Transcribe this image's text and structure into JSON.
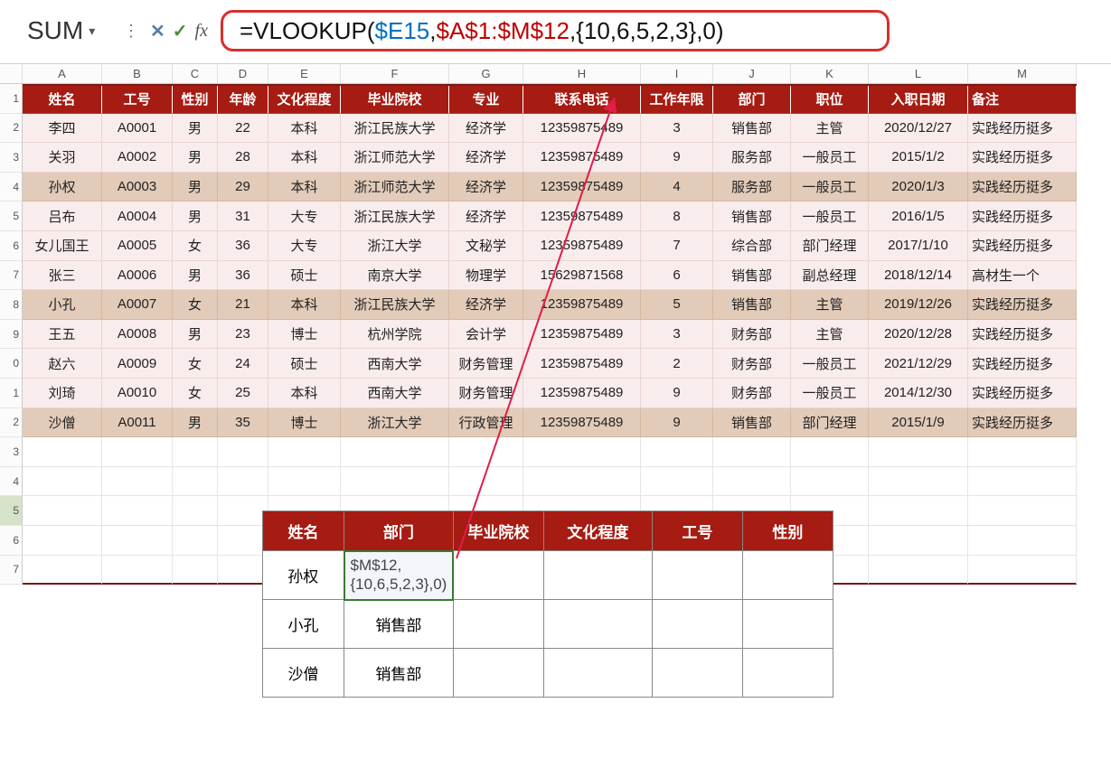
{
  "name_box": {
    "value": "SUM"
  },
  "formula": {
    "prefix": "=VLOOKUP(",
    "arg1": "$E15",
    "sep1": ",",
    "arg2": "$A$1:$M$12",
    "rest": ",{10,6,5,2,3},0)"
  },
  "col_labels": [
    "A",
    "B",
    "C",
    "D",
    "E",
    "F",
    "G",
    "H",
    "I",
    "J",
    "K",
    "L",
    "M"
  ],
  "row_labels": [
    "1",
    "2",
    "3",
    "4",
    "5",
    "6",
    "7",
    "8",
    "9",
    "0",
    "1",
    "2",
    "3",
    "4",
    "5",
    "6",
    "7"
  ],
  "selected_row_index": 14,
  "headers": {
    "name": "姓名",
    "id": "工号",
    "sex": "性别",
    "age": "年龄",
    "edu": "文化程度",
    "school": "毕业院校",
    "major": "专业",
    "phone": "联系电话",
    "years": "工作年限",
    "dept": "部门",
    "title": "职位",
    "hire": "入职日期",
    "note": "备注"
  },
  "rows": [
    {
      "name": "李四",
      "id": "A0001",
      "sex": "男",
      "age": "22",
      "edu": "本科",
      "school": "浙江民族大学",
      "major": "经济学",
      "phone": "12359875489",
      "years": "3",
      "dept": "销售部",
      "title": "主管",
      "hire": "2020/12/27",
      "note": "实践经历挺多",
      "shade": "light"
    },
    {
      "name": "关羽",
      "id": "A0002",
      "sex": "男",
      "age": "28",
      "edu": "本科",
      "school": "浙江师范大学",
      "major": "经济学",
      "phone": "12359875489",
      "years": "9",
      "dept": "服务部",
      "title": "一般员工",
      "hire": "2015/1/2",
      "note": "实践经历挺多",
      "shade": "light"
    },
    {
      "name": "孙权",
      "id": "A0003",
      "sex": "男",
      "age": "29",
      "edu": "本科",
      "school": "浙江师范大学",
      "major": "经济学",
      "phone": "12359875489",
      "years": "4",
      "dept": "服务部",
      "title": "一般员工",
      "hire": "2020/1/3",
      "note": "实践经历挺多",
      "shade": "dark"
    },
    {
      "name": "吕布",
      "id": "A0004",
      "sex": "男",
      "age": "31",
      "edu": "大专",
      "school": "浙江民族大学",
      "major": "经济学",
      "phone": "12359875489",
      "years": "8",
      "dept": "销售部",
      "title": "一般员工",
      "hire": "2016/1/5",
      "note": "实践经历挺多",
      "shade": "light"
    },
    {
      "name": "女儿国王",
      "id": "A0005",
      "sex": "女",
      "age": "36",
      "edu": "大专",
      "school": "浙江大学",
      "major": "文秘学",
      "phone": "12359875489",
      "years": "7",
      "dept": "综合部",
      "title": "部门经理",
      "hire": "2017/1/10",
      "note": "实践经历挺多",
      "shade": "light"
    },
    {
      "name": "张三",
      "id": "A0006",
      "sex": "男",
      "age": "36",
      "edu": "硕士",
      "school": "南京大学",
      "major": "物理学",
      "phone": "15629871568",
      "years": "6",
      "dept": "销售部",
      "title": "副总经理",
      "hire": "2018/12/14",
      "note": "高材生一个",
      "shade": "light"
    },
    {
      "name": "小孔",
      "id": "A0007",
      "sex": "女",
      "age": "21",
      "edu": "本科",
      "school": "浙江民族大学",
      "major": "经济学",
      "phone": "12359875489",
      "years": "5",
      "dept": "销售部",
      "title": "主管",
      "hire": "2019/12/26",
      "note": "实践经历挺多",
      "shade": "dark"
    },
    {
      "name": "王五",
      "id": "A0008",
      "sex": "男",
      "age": "23",
      "edu": "博士",
      "school": "杭州学院",
      "major": "会计学",
      "phone": "12359875489",
      "years": "3",
      "dept": "财务部",
      "title": "主管",
      "hire": "2020/12/28",
      "note": "实践经历挺多",
      "shade": "light"
    },
    {
      "name": "赵六",
      "id": "A0009",
      "sex": "女",
      "age": "24",
      "edu": "硕士",
      "school": "西南大学",
      "major": "财务管理",
      "phone": "12359875489",
      "years": "2",
      "dept": "财务部",
      "title": "一般员工",
      "hire": "2021/12/29",
      "note": "实践经历挺多",
      "shade": "light"
    },
    {
      "name": "刘琦",
      "id": "A0010",
      "sex": "女",
      "age": "25",
      "edu": "本科",
      "school": "西南大学",
      "major": "财务管理",
      "phone": "12359875489",
      "years": "9",
      "dept": "财务部",
      "title": "一般员工",
      "hire": "2014/12/30",
      "note": "实践经历挺多",
      "shade": "light"
    },
    {
      "name": "沙僧",
      "id": "A0011",
      "sex": "男",
      "age": "35",
      "edu": "博士",
      "school": "浙江大学",
      "major": "行政管理",
      "phone": "12359875489",
      "years": "9",
      "dept": "销售部",
      "title": "部门经理",
      "hire": "2015/1/9",
      "note": "实践经历挺多",
      "shade": "dark"
    }
  ],
  "lookup": {
    "headers": {
      "name": "姓名",
      "dept": "部门",
      "school": "毕业院校",
      "edu": "文化程度",
      "id": "工号",
      "sex": "性别"
    },
    "rows": [
      {
        "name": "孙权",
        "dept": "$M$12,{10,6,5,2,3},0)",
        "editing": true
      },
      {
        "name": "小孔",
        "dept": "销售部"
      },
      {
        "name": "沙僧",
        "dept": "销售部"
      }
    ]
  }
}
